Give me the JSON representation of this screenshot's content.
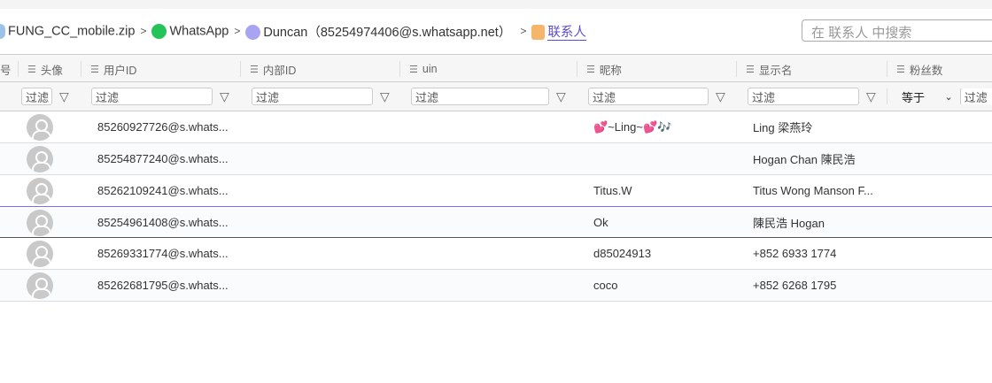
{
  "breadcrumb": {
    "items": [
      "FUNG_CC_mobile.zip",
      "WhatsApp",
      "Duncan（85254974406@s.whatsapp.net）",
      "联系人"
    ]
  },
  "search": {
    "placeholder": "在 联系人 中搜索"
  },
  "columns": [
    "号",
    "头像",
    "用户ID",
    "内部ID",
    "uin",
    "昵称",
    "显示名",
    "粉丝数"
  ],
  "filter": {
    "placeholder": "过滤",
    "equals": "等于"
  },
  "rows": [
    {
      "user_id": "85260927726@s.whats...",
      "nickname": "💕~Ling~💕🎶",
      "display": "Ling 梁燕玲"
    },
    {
      "user_id": "85254877240@s.whats...",
      "nickname": "",
      "display": "Hogan Chan 陳民浩"
    },
    {
      "user_id": "85262109241@s.whats...",
      "nickname": "Titus.W",
      "display": "Titus Wong Manson F..."
    },
    {
      "user_id": "85254961408@s.whats...",
      "nickname": "Ok",
      "display": "陳民浩 Hogan"
    },
    {
      "user_id": "85269331774@s.whats...",
      "nickname": "d85024913",
      "display": "+852 6933 1774"
    },
    {
      "user_id": "85262681795@s.whats...",
      "nickname": "coco",
      "display": "+852 6268 1795"
    }
  ]
}
